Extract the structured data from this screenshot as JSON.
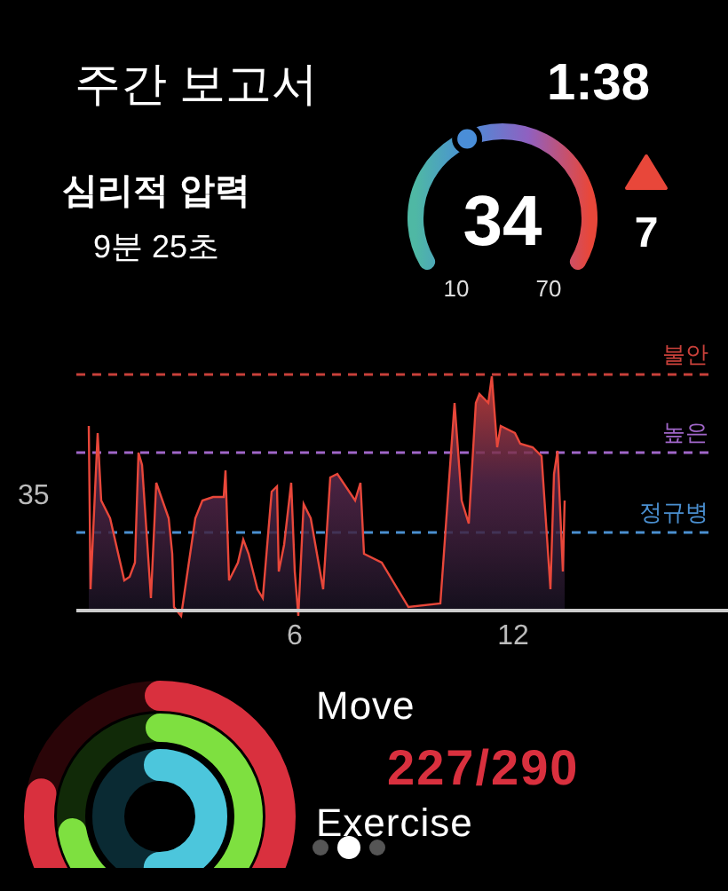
{
  "header": {
    "title": "주간 보고서",
    "time": "1:38"
  },
  "stress": {
    "label": "심리적 압력",
    "duration": "9분 25초",
    "gauge": {
      "value": "34",
      "min": "10",
      "max": "70"
    },
    "trend": {
      "value": "7"
    }
  },
  "chart": {
    "y_tick": "35",
    "x_ticks": [
      "6",
      "12"
    ],
    "thresholds": [
      {
        "label": "불안",
        "color": "#c8403a"
      },
      {
        "label": "높은",
        "color": "#a066c8"
      },
      {
        "label": "정규병",
        "color": "#4a8fd0"
      }
    ]
  },
  "activity": {
    "move": {
      "label": "Move",
      "value": "227/290"
    },
    "next_label": "Exercise",
    "page_dots": [
      {
        "selected": false
      },
      {
        "selected": true
      },
      {
        "selected": false
      }
    ]
  }
}
